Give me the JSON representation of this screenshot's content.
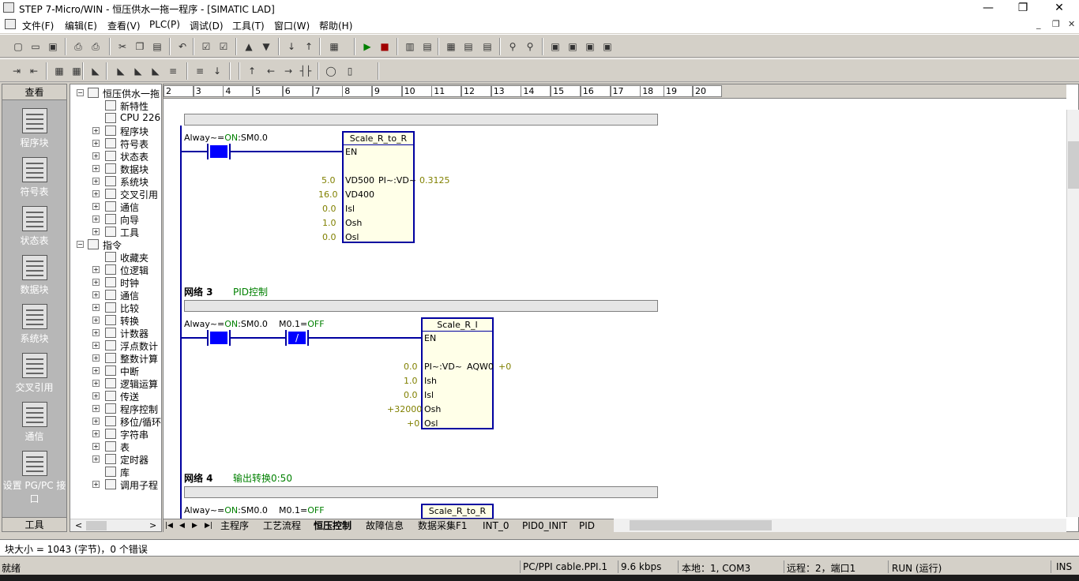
{
  "window": {
    "title": "STEP 7-Micro/WIN - 恒压供水一拖一程序 - [SIMATIC LAD]",
    "controls": {
      "minimize": "—",
      "restore": "❐",
      "close": "✕"
    }
  },
  "menu": {
    "items": [
      "文件(F)",
      "编辑(E)",
      "查看(V)",
      "PLC(P)",
      "调试(D)",
      "工具(T)",
      "窗口(W)",
      "帮助(H)"
    ],
    "mdi_controls": {
      "minimize": "_",
      "restore": "❐",
      "close": "✕"
    }
  },
  "toolbar1": {
    "icons": [
      "new-icon",
      "open-icon",
      "save-icon",
      "print-icon",
      "print-preview-icon",
      "cut-icon",
      "copy-icon",
      "paste-icon",
      "undo-icon",
      "compile-icon",
      "compile-all-icon",
      "upload-icon",
      "download-icon",
      "sort-ascending-icon",
      "sort-descending-icon",
      "options-icon",
      "run-icon",
      "stop-icon",
      "program-status-icon",
      "trend-icon",
      "status-chart-icon",
      "chart-single-read-icon",
      "chart-write-icon",
      "force-icon",
      "unforce-icon",
      "lock-icon",
      "unlock-icon",
      "read-all-forced-icon",
      "read-forced-icon"
    ]
  },
  "toolbar2": {
    "icons": [
      "insert-network-icon",
      "delete-network-icon",
      "toggle-poe-icon",
      "symbol-table-icon",
      "bookmark-icon",
      "next-bookmark-icon",
      "prev-bookmark-icon",
      "clear-bookmarks-icon",
      "apply-symbols-icon",
      "symbol-info-icon",
      "line-down-icon",
      "line-up-icon",
      "line-left-icon",
      "line-right-icon",
      "contact-icon",
      "coil-icon",
      "box-icon"
    ]
  },
  "navbar": {
    "header": "查看",
    "footer": "工具",
    "items": [
      {
        "label": "程序块",
        "icon": "program-block-icon"
      },
      {
        "label": "符号表",
        "icon": "symbol-table-icon"
      },
      {
        "label": "状态表",
        "icon": "status-chart-icon"
      },
      {
        "label": "数据块",
        "icon": "data-block-icon"
      },
      {
        "label": "系统块",
        "icon": "system-block-icon"
      },
      {
        "label": "交叉引用",
        "icon": "cross-reference-icon"
      },
      {
        "label": "通信",
        "icon": "communications-icon"
      },
      {
        "label": "设置 PG/PC 接口",
        "icon": "set-pgpc-icon"
      }
    ]
  },
  "tree": {
    "items": [
      {
        "label": "恒压供水一拖",
        "pm": "⊟",
        "level": 0
      },
      {
        "label": "新特性",
        "pm": "",
        "level": 1
      },
      {
        "label": "CPU 226",
        "pm": "",
        "level": 1
      },
      {
        "label": "程序块",
        "pm": "⊞",
        "level": 1
      },
      {
        "label": "符号表",
        "pm": "⊞",
        "level": 1
      },
      {
        "label": "状态表",
        "pm": "⊞",
        "level": 1
      },
      {
        "label": "数据块",
        "pm": "⊞",
        "level": 1
      },
      {
        "label": "系统块",
        "pm": "⊞",
        "level": 1
      },
      {
        "label": "交叉引用",
        "pm": "⊞",
        "level": 1
      },
      {
        "label": "通信",
        "pm": "⊞",
        "level": 1
      },
      {
        "label": "向导",
        "pm": "⊞",
        "level": 1
      },
      {
        "label": "工具",
        "pm": "⊞",
        "level": 1
      },
      {
        "label": "指令",
        "pm": "⊟",
        "level": 0
      },
      {
        "label": "收藏夹",
        "pm": "",
        "level": 1
      },
      {
        "label": "位逻辑",
        "pm": "⊞",
        "level": 1
      },
      {
        "label": "时钟",
        "pm": "⊞",
        "level": 1
      },
      {
        "label": "通信",
        "pm": "⊞",
        "level": 1
      },
      {
        "label": "比较",
        "pm": "⊞",
        "level": 1
      },
      {
        "label": "转换",
        "pm": "⊞",
        "level": 1
      },
      {
        "label": "计数器",
        "pm": "⊞",
        "level": 1
      },
      {
        "label": "浮点数计",
        "pm": "⊞",
        "level": 1
      },
      {
        "label": "整数计算",
        "pm": "⊞",
        "level": 1
      },
      {
        "label": "中断",
        "pm": "⊞",
        "level": 1
      },
      {
        "label": "逻辑运算",
        "pm": "⊞",
        "level": 1
      },
      {
        "label": "传送",
        "pm": "⊞",
        "level": 1
      },
      {
        "label": "程序控制",
        "pm": "⊞",
        "level": 1
      },
      {
        "label": "移位/循环",
        "pm": "⊞",
        "level": 1
      },
      {
        "label": "字符串",
        "pm": "⊞",
        "level": 1
      },
      {
        "label": "表",
        "pm": "⊞",
        "level": 1
      },
      {
        "label": "定时器",
        "pm": "⊞",
        "level": 1
      },
      {
        "label": "库",
        "pm": "",
        "level": 1
      },
      {
        "label": "调用子程",
        "pm": "⊞",
        "level": 1
      }
    ],
    "scroll_left": "<",
    "scroll_right": ">"
  },
  "ruler": {
    "cells": [
      "2",
      "3",
      "4",
      "5",
      "6",
      "7",
      "8",
      "9",
      "10",
      "11",
      "12",
      "13",
      "14",
      "15",
      "16",
      "17",
      "18",
      "19",
      "20"
    ]
  },
  "ladder": {
    "net2": {
      "contact_label": "Alway~=ON:SM0.0",
      "contact_prefix": "Alway~=",
      "contact_state": "ON",
      "contact_addr": ":SM0.0",
      "box_title": "Scale_R_to_R",
      "en": "EN",
      "pins": [
        {
          "value": "5.0",
          "name": "VD500"
        },
        {
          "value": "16.0",
          "name": "VD400"
        },
        {
          "value": "0.0",
          "name": "Isl"
        },
        {
          "value": "1.0",
          "name": "Osh"
        },
        {
          "value": "0.0",
          "name": "Osl"
        }
      ],
      "output_name": "PI~:VD~",
      "output_value": "0.3125"
    },
    "net3": {
      "title": "网络 3",
      "comment": "PID控制",
      "contact1_prefix": "Alway~=",
      "contact1_state": "ON",
      "contact1_addr": ":SM0.0",
      "contact2_prefix": "M0.1=",
      "contact2_state": "OFF",
      "box_title": "Scale_R_I",
      "en": "EN",
      "pins": [
        {
          "value": "0.0",
          "name": "PI~:VD~"
        },
        {
          "value": "1.0",
          "name": "Ish"
        },
        {
          "value": "0.0",
          "name": "Isl"
        },
        {
          "value": "+32000",
          "name": "Osh"
        },
        {
          "value": "+0",
          "name": "Osl"
        }
      ],
      "output_name": "AQW0",
      "output_value": "+0",
      "neg_symbol": "/"
    },
    "net4": {
      "title": "网络 4",
      "comment": "输出转换0:50",
      "contact1_prefix": "Alway~=",
      "contact1_state": "ON",
      "contact1_addr": ":SM0.0",
      "contact2_prefix": "M0.1=",
      "contact2_state": "OFF",
      "box_title": "Scale_R_to_R"
    }
  },
  "tabs": {
    "nav": [
      "|◀",
      "◀",
      "▶",
      "▶|"
    ],
    "items": [
      "主程序",
      "工艺流程",
      "恒压控制",
      "故障信息",
      "数据采集F1",
      "INT_0",
      "PID0_INIT",
      "PID"
    ],
    "active": "恒压控制"
  },
  "message": "块大小 = 1043 (字节)，0 个错误",
  "status": {
    "ready": "就绪",
    "cable": "PC/PPI cable.PPI.1",
    "speed": "9.6 kbps",
    "local": "本地：1, COM3",
    "remote": "远程：2，端口1",
    "mode": "RUN (运行)",
    "ins": "INS"
  },
  "colors": {
    "wire": "#0000a0",
    "contact_on": "#0000ff",
    "status_green": "#008000",
    "value_olive": "#808000"
  }
}
